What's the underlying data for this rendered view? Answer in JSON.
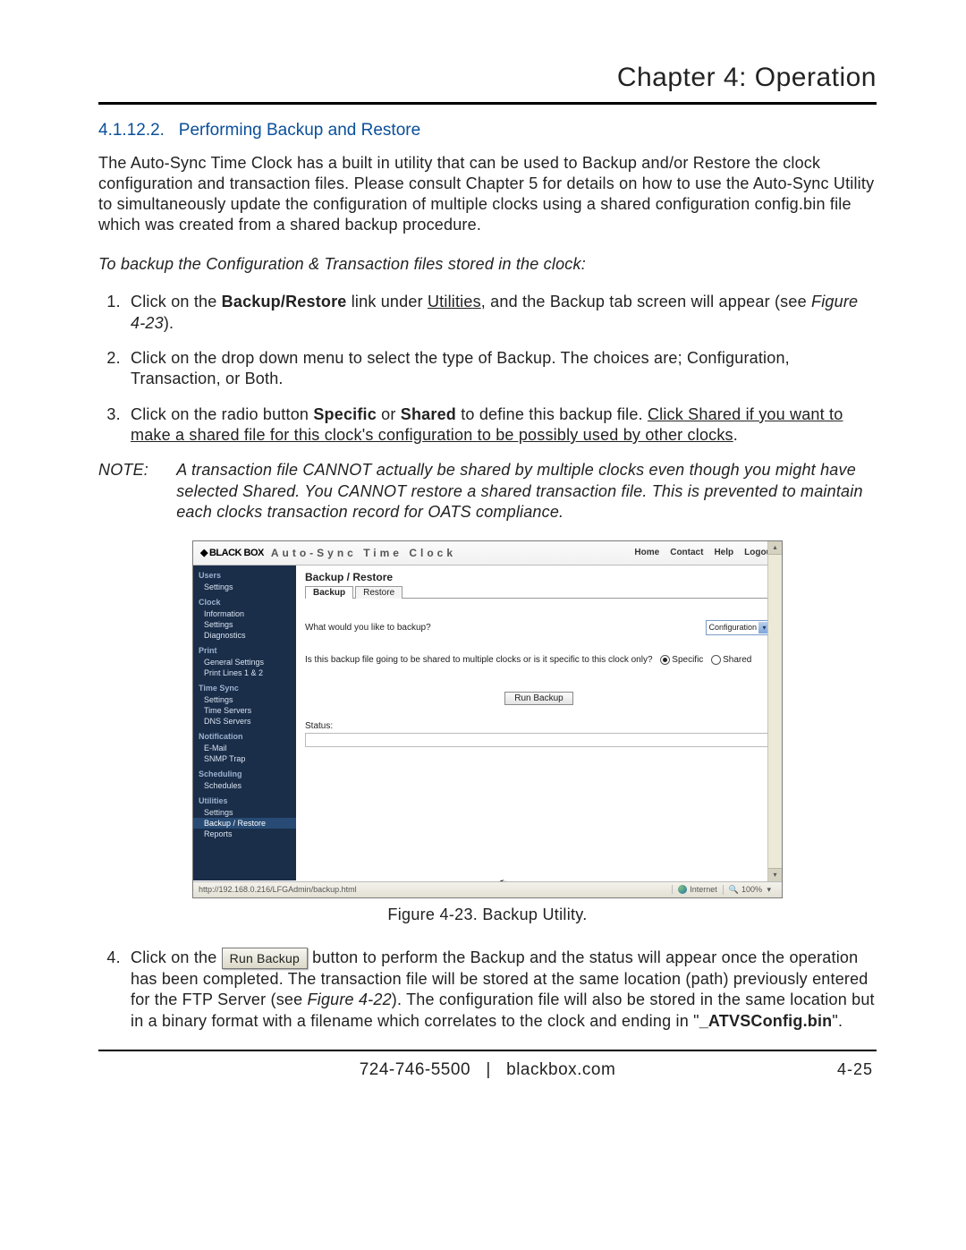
{
  "header": {
    "chapter_title": "Chapter 4: Operation"
  },
  "section": {
    "number": "4.1.12.2.",
    "title": "Performing Backup and Restore"
  },
  "intro_para": "The Auto-Sync Time Clock has a built in utility that can be used to Backup and/or Restore the clock configuration and transaction files. Please consult Chapter 5 for details on how to use the Auto-Sync Utility to simultaneously update the configuration of multiple clocks using a shared configuration config.bin file which was created from a shared backup procedure.",
  "lead_sentence": "To backup the Configuration & Transaction files stored in the clock:",
  "step1": {
    "pre": "Click on the ",
    "bold": "Backup/Restore",
    "mid": " link under ",
    "u1": "Utilities",
    "post": ", and the Backup tab screen will appear (see ",
    "fig": "Figure 4-23",
    "end": ")."
  },
  "step2": "Click on the drop down menu to select the type of Backup. The choices are; Configuration, Transaction, or Both.",
  "step3": {
    "pre": "Click on the radio button ",
    "b1": "Specific",
    "mid1": " or ",
    "b2": "Shared",
    "mid2": " to define this backup file. ",
    "u1": "Click Shared if you want to make a shared file for this clock's configuration to be possibly used by other clocks",
    "end": "."
  },
  "note": {
    "label": "NOTE:",
    "body": "A transaction file CANNOT actually be shared by multiple clocks even though you might have selected Shared. You CANNOT restore a shared transaction file. This is prevented to maintain each clocks transaction record for OATS compliance."
  },
  "embed": {
    "logo_text": "BLACK BOX",
    "app_title": "Auto-Sync Time Clock",
    "nav": {
      "home": "Home",
      "contact": "Contact",
      "help": "Help",
      "logout": "Logout"
    },
    "sidebar": {
      "groups": [
        {
          "head": "Users",
          "items": [
            "Settings"
          ]
        },
        {
          "head": "Clock",
          "items": [
            "Information",
            "Settings",
            "Diagnostics"
          ]
        },
        {
          "head": "Print",
          "items": [
            "General Settings",
            "Print Lines 1 & 2"
          ]
        },
        {
          "head": "Time Sync",
          "items": [
            "Settings",
            "Time Servers",
            "DNS Servers"
          ]
        },
        {
          "head": "Notification",
          "items": [
            "E-Mail",
            "SNMP Trap"
          ]
        },
        {
          "head": "Scheduling",
          "items": [
            "Schedules"
          ]
        },
        {
          "head": "Utilities",
          "items": [
            "Settings",
            "Backup / Restore",
            "Reports"
          ]
        }
      ],
      "selected": "Backup / Restore"
    },
    "panel": {
      "title": "Backup / Restore",
      "tabs": {
        "active": "Backup",
        "other": "Restore"
      },
      "question": "What would you like to backup?",
      "select_value": "Configuration",
      "radio_q": "Is this backup file going to be shared to multiple clocks or is it specific to this clock only?",
      "radios": {
        "specific": "Specific",
        "shared": "Shared",
        "checked": "Specific"
      },
      "run_button": "Run Backup",
      "status_label": "Status:"
    },
    "statusbar": {
      "url": "http://192.168.0.216/LFGAdmin/backup.html",
      "zone": "Internet",
      "zoom": "100%"
    }
  },
  "figure_caption": "Figure 4-23.  Backup Utility.",
  "step4": {
    "pre": "Click on the ",
    "btn": "Run Backup",
    "mid": " button to perform the Backup and the status will appear once the operation has been completed. The transaction file will be stored at the same location (path) previously entered for the FTP Server (see ",
    "fig": "Figure 4-22",
    "post": "). The configuration file will also be stored in the same location but in a binary format with a filename which correlates to the clock and ending in \"",
    "bold_name": "_ATVSConfig.bin",
    "end": "\"."
  },
  "footer": {
    "phone": "724-746-5500",
    "sep": "|",
    "site": "blackbox.com",
    "page": "4-25"
  }
}
